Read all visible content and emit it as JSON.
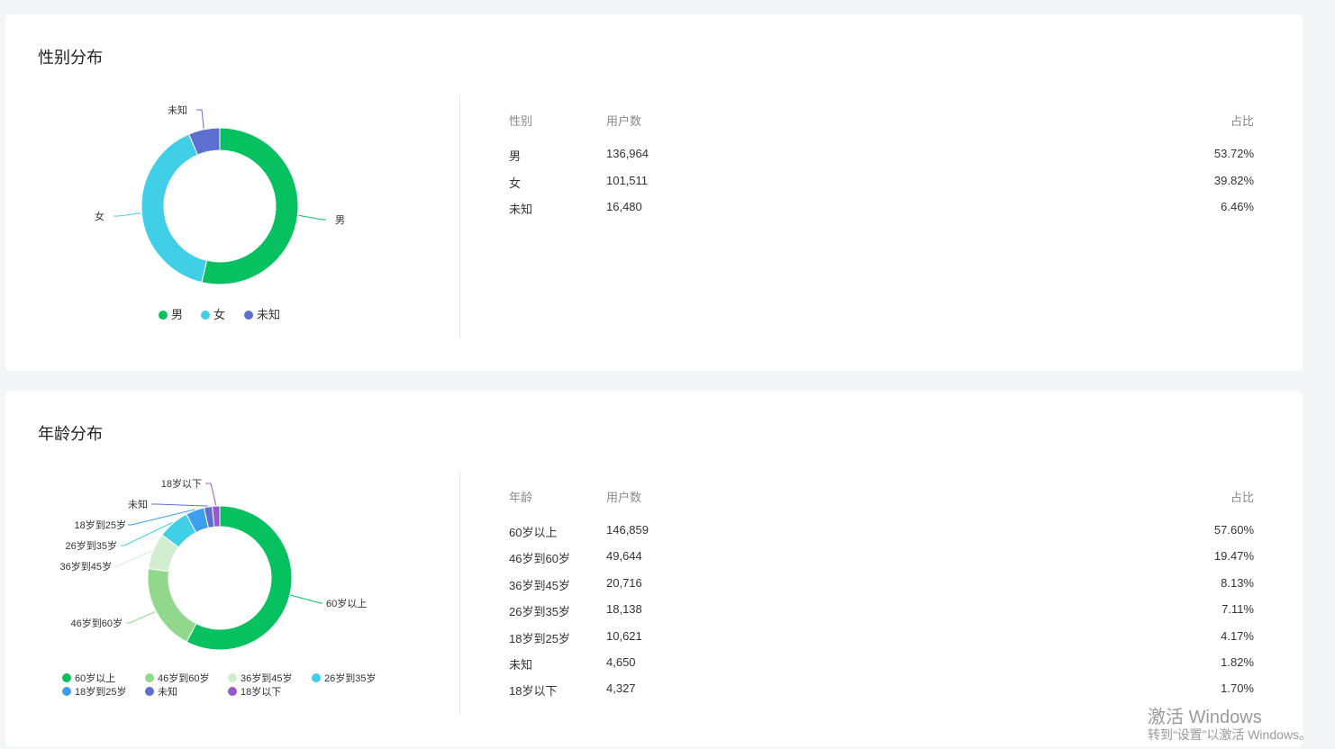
{
  "gender": {
    "title": "性别分布",
    "table": {
      "headers": [
        "性别",
        "用户数",
        "占比"
      ],
      "rows": [
        [
          "男",
          "136,964",
          "53.72%"
        ],
        [
          "女",
          "101,511",
          "39.82%"
        ],
        [
          "未知",
          "16,480",
          "6.46%"
        ]
      ]
    }
  },
  "age": {
    "title": "年龄分布",
    "table": {
      "headers": [
        "年龄",
        "用户数",
        "占比"
      ],
      "rows": [
        [
          "60岁以上",
          "146,859",
          "57.60%"
        ],
        [
          "46岁到60岁",
          "49,644",
          "19.47%"
        ],
        [
          "36岁到45岁",
          "20,716",
          "8.13%"
        ],
        [
          "26岁到35岁",
          "18,138",
          "7.11%"
        ],
        [
          "18岁到25岁",
          "10,621",
          "4.17%"
        ],
        [
          "未知",
          "4,650",
          "1.82%"
        ],
        [
          "18岁以下",
          "4,327",
          "1.70%"
        ]
      ]
    }
  },
  "chart_data": [
    {
      "type": "pie",
      "title": "性别分布",
      "categories": [
        "男",
        "女",
        "未知"
      ],
      "values": [
        136964,
        101511,
        16480
      ],
      "colors": [
        "#07c160",
        "#40cfe6",
        "#5e70cf"
      ],
      "legend": "bottom"
    },
    {
      "type": "pie",
      "title": "年龄分布",
      "categories": [
        "60岁以上",
        "46岁到60岁",
        "36岁到45岁",
        "26岁到35岁",
        "18岁到25岁",
        "未知",
        "18岁以下"
      ],
      "values": [
        146859,
        49644,
        20716,
        18138,
        10621,
        4650,
        4327
      ],
      "colors": [
        "#07c160",
        "#91d88c",
        "#d0eecf",
        "#40cfe6",
        "#3e9ef0",
        "#5e70cf",
        "#9658cc"
      ],
      "legend": "bottom"
    }
  ],
  "watermark": {
    "line1": "激活 Windows",
    "line2": "转到“设置”以激活 Windows。"
  }
}
